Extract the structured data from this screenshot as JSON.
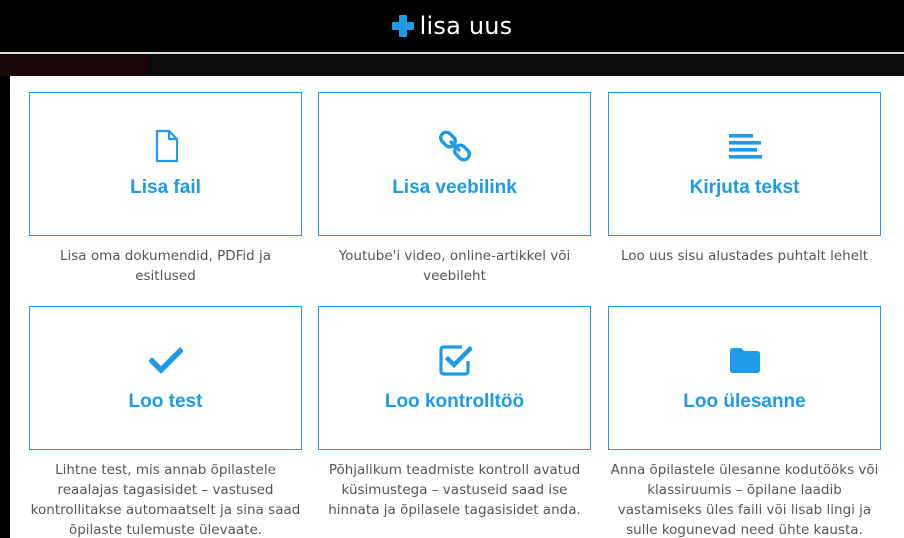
{
  "header": {
    "title": "lisa uus",
    "icon": "plus-icon",
    "accent": "#1e9be6"
  },
  "cards": [
    {
      "label": "Lisa fail",
      "icon": "file-icon",
      "description": "Lisa oma dokumendid, PDFid ja esitlused"
    },
    {
      "label": "Lisa veebilink",
      "icon": "link-icon",
      "description": "Youtube'i video, online-artikkel või veebileht"
    },
    {
      "label": "Kirjuta tekst",
      "icon": "align-left-icon",
      "description": "Loo uus sisu alustades puhtalt lehelt"
    },
    {
      "label": "Loo test",
      "icon": "check-icon",
      "description": "Lihtne test, mis annab õpilastele reaalajas tagasisidet – vastused kontrollitakse automaatselt ja sina saad õpilaste tulemuste ülevaate."
    },
    {
      "label": "Loo kontrolltöö",
      "icon": "checkbox-icon",
      "description": "Põhjalikum teadmiste kontroll avatud küsimustega – vastuseid saad ise hinnata ja õpilasele tagasisidet anda."
    },
    {
      "label": "Loo ülesanne",
      "icon": "folder-icon",
      "description": "Anna õpilastele ülesanne kodutööks või klassiruumis – õpilane laadib vastamiseks üles faili või lisab lingi ja sulle kogunevad need ühte kausta."
    }
  ]
}
